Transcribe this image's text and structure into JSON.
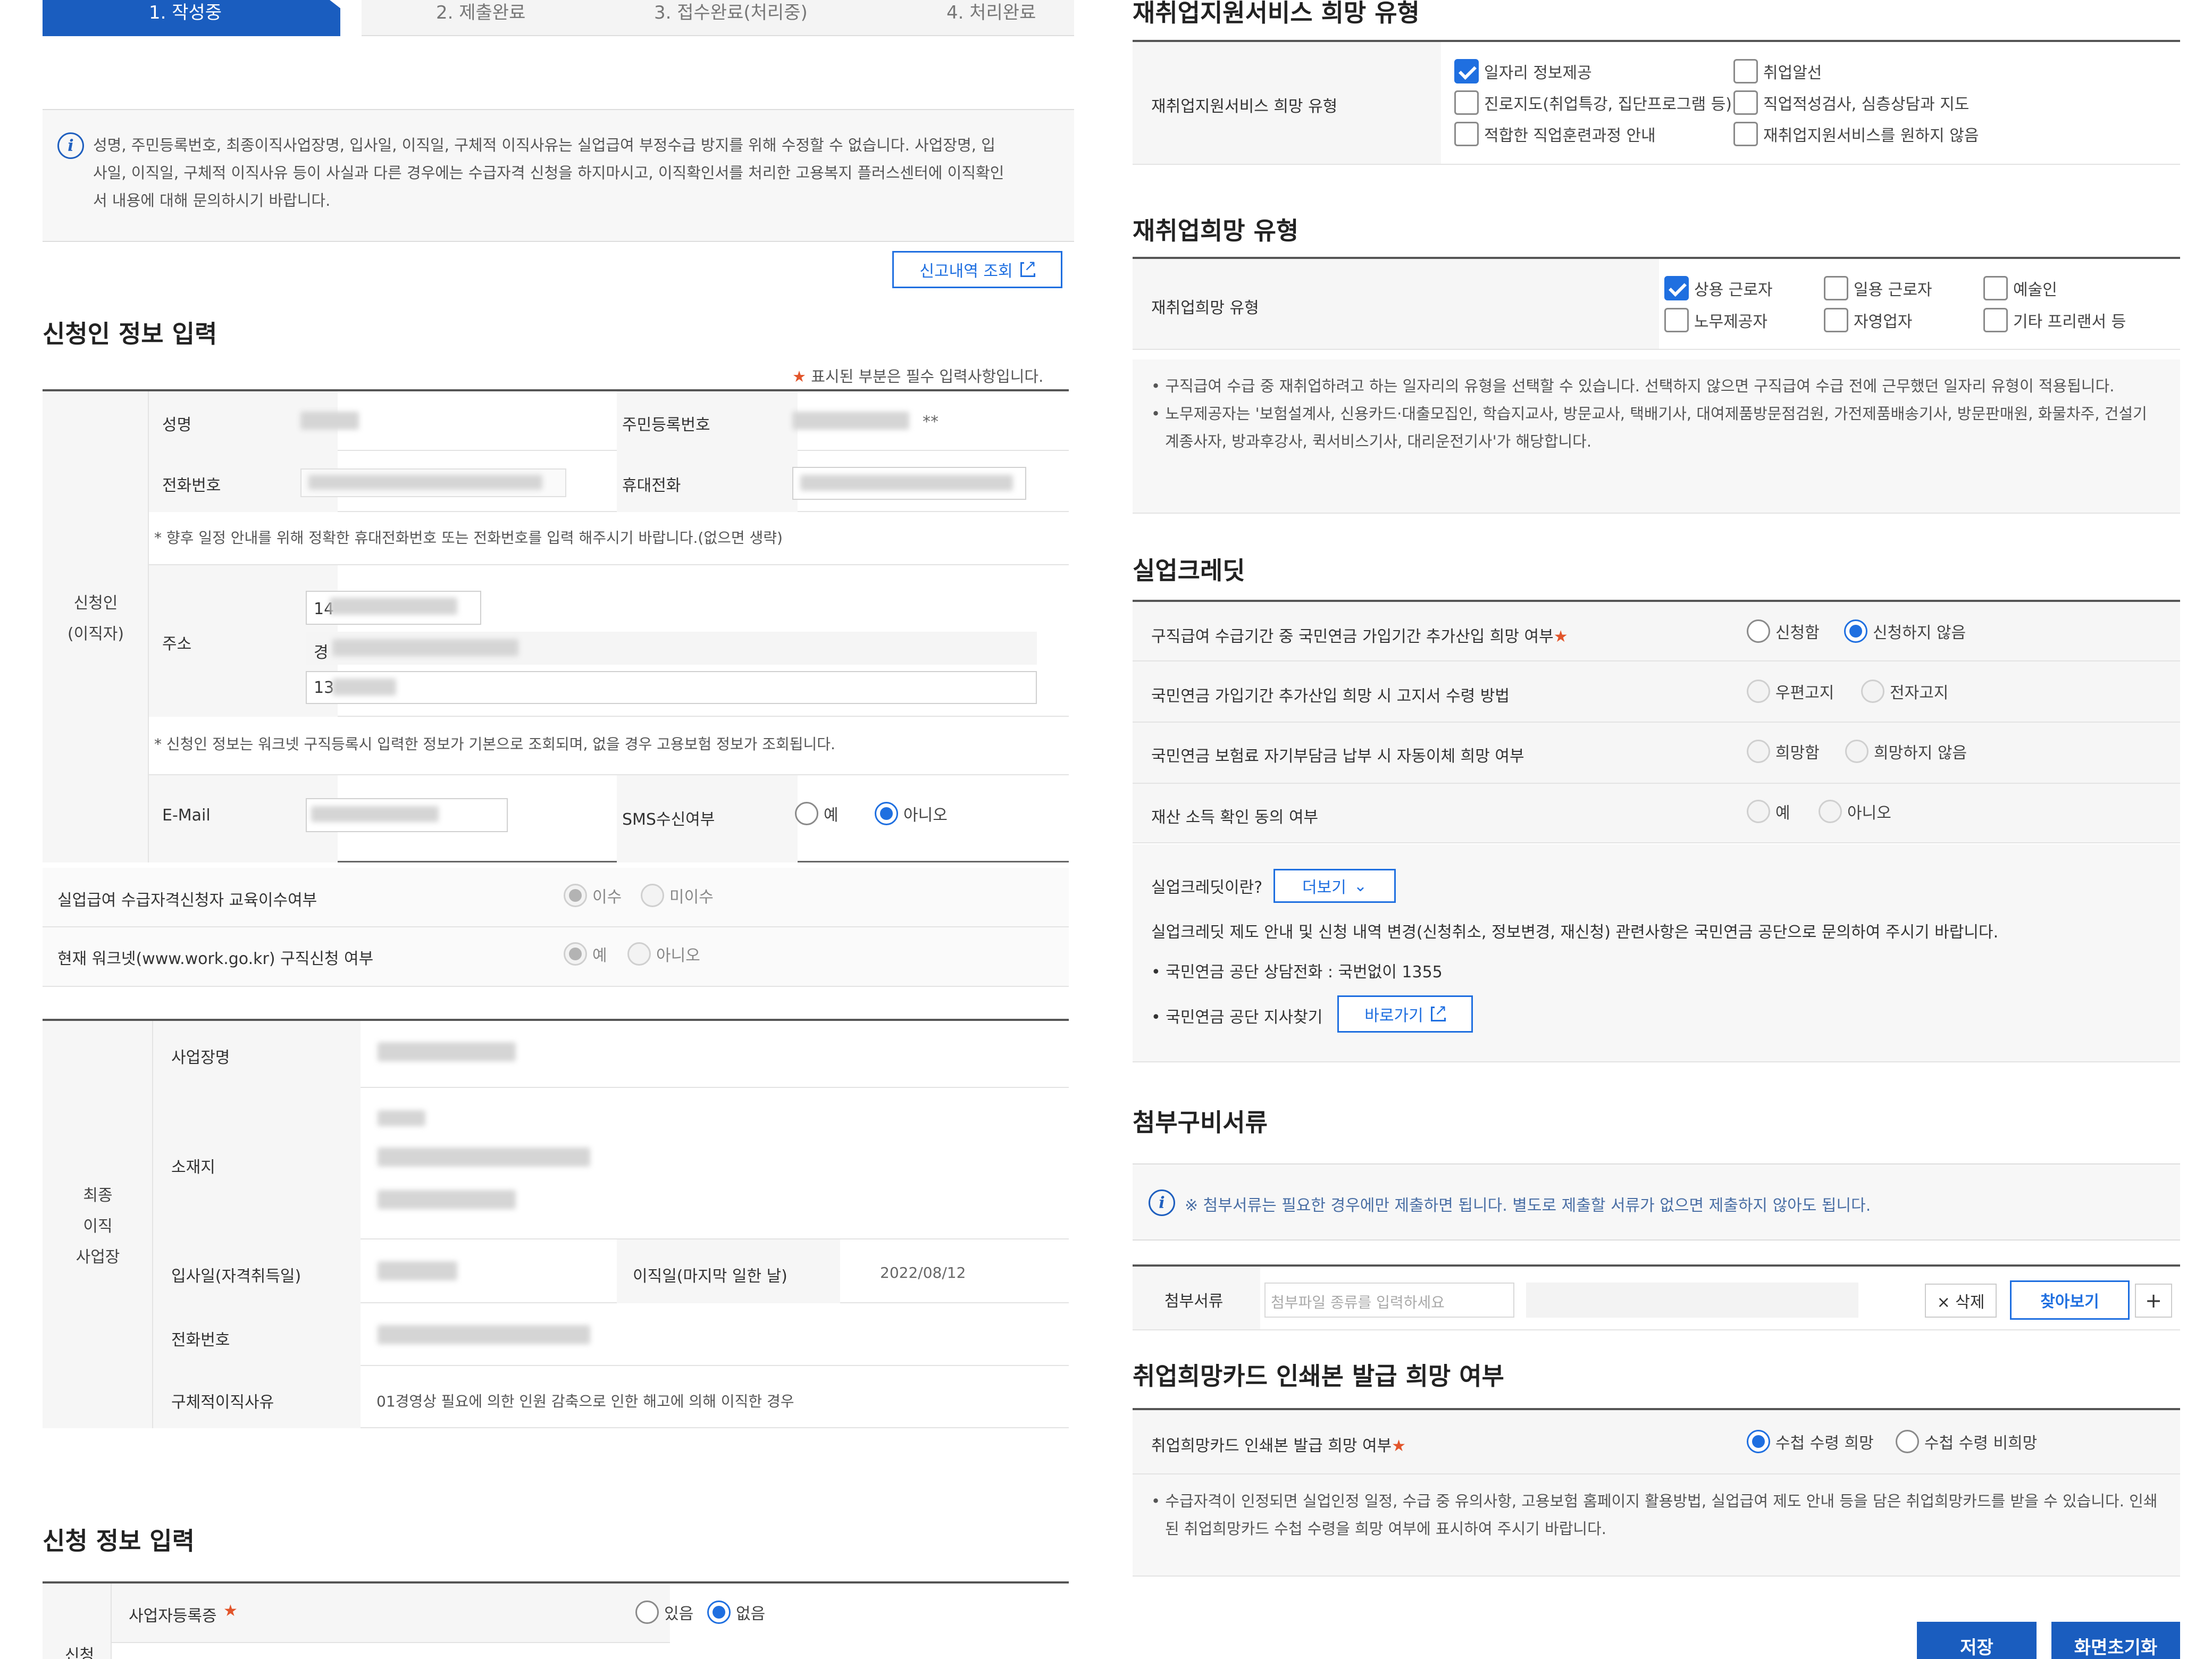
{
  "steps": [
    "1. 작성중",
    "2. 제출완료",
    "3. 접수완료(처리중)",
    "4. 처리완료"
  ],
  "notice": {
    "icon": "info-icon",
    "text": "성명, 주민등록번호, 최종이직사업장명, 입사일, 이직일, 구체적 이직사유는 실업급여 부정수급 방지를 위해 수정할 수 없습니다. 사업장명, 입사일, 이직일, 구체적 이직사유 등이 사실과 다른 경우에는 수급자격 신청을 하지마시고, 이직확인서를 처리한 고용복지 플러스센터에 이직확인서 내용에 대해 문의하시기 바랍니다."
  },
  "report_button": "신고내역 조회",
  "applicant": {
    "title": "신청인 정보 입력",
    "required_note": "표시된 부분은 필수 입력사항입니다.",
    "group_label": "신청인\n(이직자)",
    "name_label": "성명",
    "rrn_label": "주민등록번호",
    "rrn_mask": "**",
    "phone_label": "전화번호",
    "mobile_label": "휴대전화",
    "phone_note": "* 향후 일정 안내를 위해 정확한 휴대전화번호 또는 전화번호를 입력 해주시기 바랍니다.(없으면 생략)",
    "address_label": "주소",
    "addr_prefix1": "14",
    "addr_prefix2": "경",
    "addr_prefix3": "13",
    "info_note": "* 신청인 정보는 워크넷 구직등록시 입력한 정보가 기본으로 조회되며, 없을 경우 고용보험 정보가 조회됩니다.",
    "email_label": "E-Mail",
    "sms_label": "SMS수신여부",
    "sms_yes": "예",
    "sms_no": "아니오"
  },
  "edu": {
    "label": "실업급여 수급자격신청자 교육이수여부",
    "opt1": "이수",
    "opt2": "미이수"
  },
  "worknet": {
    "label": "현재 워크넷(www.work.go.kr) 구직신청 여부",
    "opt1": "예",
    "opt2": "아니오"
  },
  "workplace": {
    "group_label": "최종\n이직\n사업장",
    "name_label": "사업장명",
    "location_label": "소재지",
    "join_label": "입사일(자격취득일)",
    "leave_label": "이직일(마지막 일한 날)",
    "leave_date": "2022/08/12",
    "phone_label": "전화번호",
    "reason_label": "구체적이직사유",
    "reason": "01경영상 필요에 의한 인원 감축으로 인한 해고에 의해 이직한 경우"
  },
  "apply": {
    "title": "신청 정보 입력",
    "group_label": "신청",
    "biz_label": "사업자등록증",
    "opt1": "있음",
    "opt2": "없음"
  },
  "reemp_service": {
    "title": "재취업지원서비스 희망 유형",
    "row_label": "재취업지원서비스 희망 유형",
    "options": [
      "일자리 정보제공",
      "취업알선",
      "진로지도(취업특강, 집단프로그램 등)",
      "직업적성검사, 심층상담과 지도",
      "적합한 직업훈련과정 안내",
      "재취업지원서비스를 원하지 않음"
    ]
  },
  "reemp_type": {
    "title": "재취업희망 유형",
    "row_label": "재취업희망 유형",
    "options": [
      "상용 근로자",
      "일용 근로자",
      "예술인",
      "노무제공자",
      "자영업자",
      "기타 프리랜서 등"
    ],
    "notes": [
      "구직급여 수급 중 재취업하려고 하는 일자리의 유형을 선택할 수 있습니다. 선택하지 않으면 구직급여 수급 전에 근무했던 일자리 유형이 적용됩니다.",
      "노무제공자는 '보험설계사, 신용카드·대출모집인, 학습지교사, 방문교사, 택배기사, 대여제품방문점검원, 가전제품배송기사, 방문판매원, 화물차주, 건설기계종사자, 방과후강사, 퀵서비스기사, 대리운전기사'가 해당합니다."
    ]
  },
  "credit": {
    "title": "실업크레딧",
    "q1": "구직급여 수급기간 중 국민연금 가입기간 추가산입 희망 여부",
    "q1_o1": "신청함",
    "q1_o2": "신청하지 않음",
    "q2": "국민연금 가입기간 추가산입 희망 시 고지서 수령 방법",
    "q2_o1": "우편고지",
    "q2_o2": "전자고지",
    "q3": "국민연금 보험료 자기부담금 납부 시 자동이체 희망 여부",
    "q3_o1": "희망함",
    "q3_o2": "희망하지 않음",
    "q4": "재산 소득 확인 동의 여부",
    "q4_o1": "예",
    "q4_o2": "아니오",
    "what": "실업크레딧이란?",
    "more": "더보기",
    "info": "실업크레딧 제도 안내 및 신청 내역 변경(신청취소, 정보변경, 재신청) 관련사항은 국민연금 공단으로 문의하여 주시기 바랍니다.",
    "phone": "• 국민연금 공단 상담전화 : 국번없이 1355",
    "branch": "• 국민연금 공단 지사찾기",
    "go": "바로가기"
  },
  "attach": {
    "title": "첨부구비서류",
    "note": "※ 첨부서류는 필요한 경우에만 제출하면 됩니다. 별도로 제출할 서류가 없으면 제출하지 않아도 됩니다.",
    "label": "첨부서류",
    "placeholder": "첨부파일 종류를 입력하세요",
    "delete": "× 삭제",
    "browse": "찾아보기",
    "add": "+"
  },
  "card": {
    "title": "취업희망카드 인쇄본 발급 희망 여부",
    "row_label": "취업희망카드 인쇄본 발급 희망 여부",
    "opt1": "수첩 수령 희망",
    "opt2": "수첩 수령 비희망",
    "note": "수급자격이 인정되면 실업인정 일정, 수급 중 유의사항, 고용보험 홈페이지 활용방법, 실업급여 제도 안내 등을 담은 취업희망카드를 받을 수 있습니다. 인쇄된 취업희망카드 수첩 수령을 희망 여부에 표시하여 주시기 바랍니다."
  },
  "actions": {
    "save": "저장",
    "reset": "화면초기화"
  },
  "colors": {
    "primary": "#1a5dbf",
    "accent": "#1f6fe0",
    "required": "#e2552b"
  }
}
